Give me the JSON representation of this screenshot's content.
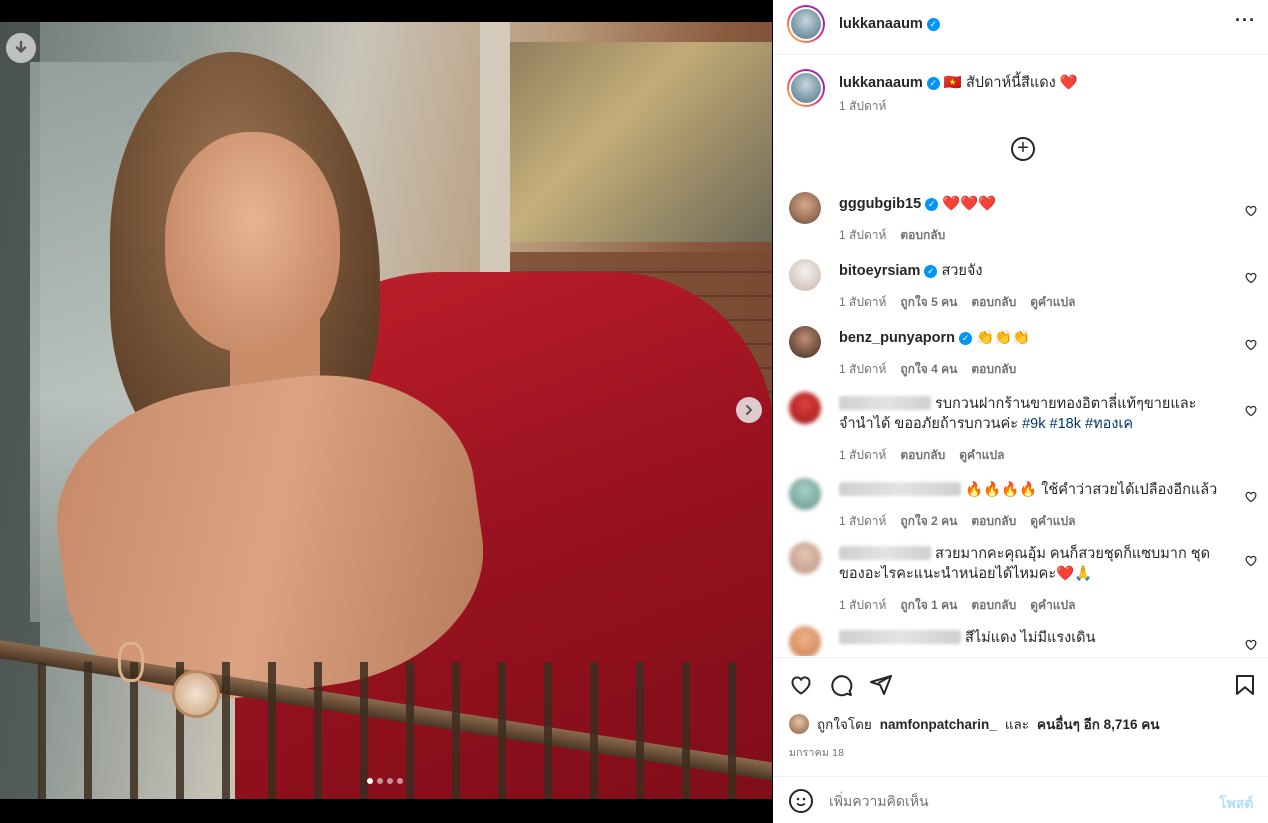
{
  "post": {
    "author": "lukkanaaum",
    "caption_flag": "🇻🇳",
    "caption_text": "สัปดาห์นี้สีแดง",
    "caption_emoji": "❤️",
    "caption_age": "1 สัปดาห์",
    "carousel": {
      "count": 4,
      "current_index": 0
    }
  },
  "comments": [
    {
      "user": "gggubgib15",
      "verified": true,
      "text": "❤️❤️❤️",
      "age": "1 สัปดาห์",
      "likes": "",
      "reply": "ตอบกลับ",
      "translate": ""
    },
    {
      "user": "bitoeyrsiam",
      "verified": true,
      "text": "สวยจัง",
      "age": "1 สัปดาห์",
      "likes": "ถูกใจ 5 คน",
      "reply": "ตอบกลับ",
      "translate": "ดูคำแปล"
    },
    {
      "user": "benz_punyaporn",
      "verified": true,
      "text": "👏👏👏",
      "age": "1 สัปดาห์",
      "likes": "ถูกใจ 4 คน",
      "reply": "ตอบกลับ",
      "translate": ""
    },
    {
      "user": "",
      "verified": false,
      "text": "รบกวนฝากร้านขายทองอิตาลี่แท้ๆขายและจำนำได้ ขออภัยถ้ารบกวนค่ะ",
      "tags": [
        "#9k",
        "#18k",
        "#ทองเค"
      ],
      "age": "1 สัปดาห์",
      "likes": "",
      "reply": "ตอบกลับ",
      "translate": "ดูคำแปล"
    },
    {
      "user": "",
      "verified": false,
      "text": "🔥🔥🔥🔥 ใช้คำว่าสวยได้เปลืองอีกแล้ว",
      "age": "1 สัปดาห์",
      "likes": "ถูกใจ 2 คน",
      "reply": "ตอบกลับ",
      "translate": "ดูคำแปล"
    },
    {
      "user": "",
      "verified": false,
      "text": "สวยมากคะคุณอุ้ม คนก็สวยชุดก็แซบมาก ชุด ของอะไรคะแนะนำหน่อยได้ไหมคะ❤️🙏",
      "age": "1 สัปดาห์",
      "likes": "ถูกใจ 1 คน",
      "reply": "ตอบกลับ",
      "translate": "ดูคำแปล"
    },
    {
      "user": "",
      "verified": false,
      "text": "สีไม่แดง ไม่มีแรงเดิน",
      "age": "",
      "likes": "",
      "reply": "",
      "translate": ""
    }
  ],
  "likes_line": {
    "prefix": "ถูกใจโดย",
    "user": "namfonpatcharin_",
    "joiner": "และ",
    "others": "คนอื่นๆ อีก 8,716 คน"
  },
  "date": "มกราคม 18",
  "composer": {
    "placeholder": "เพิ่มความคิดเห็น",
    "post_label": "โพสต์"
  },
  "colors": {
    "accent": "#0095f6",
    "post_disabled": "#b2dffc",
    "muted": "#737373"
  },
  "icons": [
    "download-icon",
    "chevron-right-icon",
    "more-icon",
    "verified-icon",
    "add-circle-icon",
    "heart-icon",
    "comment-icon",
    "share-icon",
    "bookmark-icon",
    "emoji-icon"
  ]
}
